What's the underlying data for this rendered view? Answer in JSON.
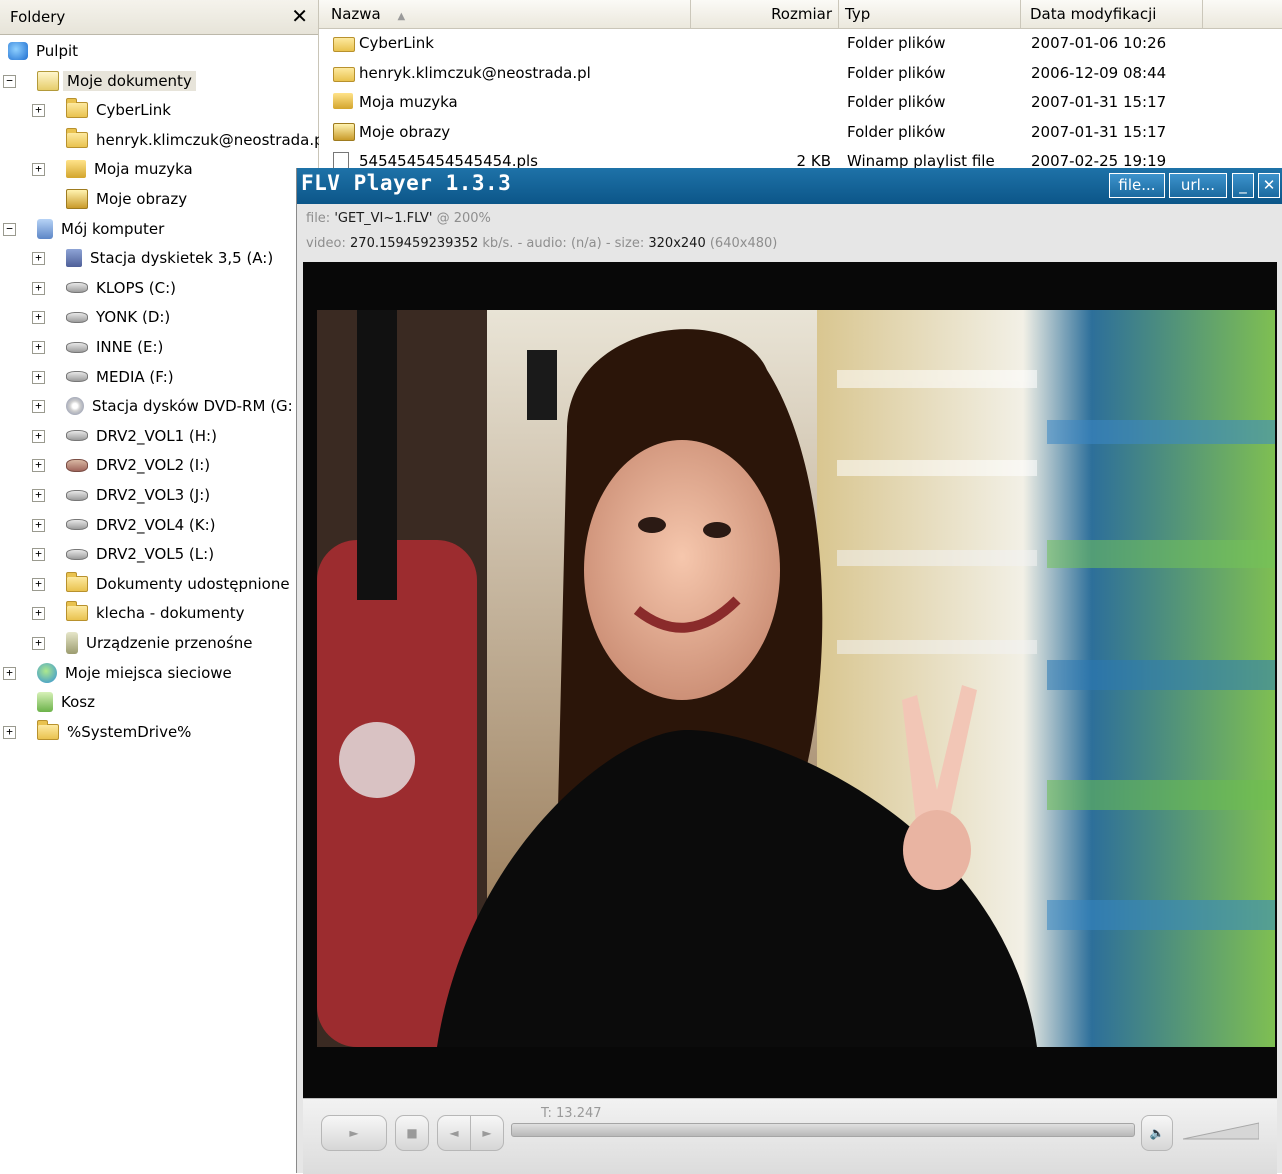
{
  "folders_pane": {
    "title": "Foldery",
    "close_label": "✕",
    "tree": [
      {
        "label": "Pulpit",
        "icon": "desktop-icon",
        "expander": ""
      },
      {
        "label": "Moje dokumenty",
        "icon": "mydocs-icon",
        "expander": "−",
        "selected": true
      },
      {
        "label": "CyberLink",
        "icon": "folder-icon",
        "expander": "+"
      },
      {
        "label": "henryk.klimczuk@neostrada.p",
        "icon": "folder-icon",
        "expander": ""
      },
      {
        "label": "Moja muzyka",
        "icon": "music-folder-icon",
        "expander": "+"
      },
      {
        "label": "Moje obrazy",
        "icon": "pictures-folder-icon",
        "expander": ""
      },
      {
        "label": "Mój komputer",
        "icon": "computer-icon",
        "expander": "−"
      },
      {
        "label": "Stacja dyskietek 3,5 (A:)",
        "icon": "floppy-icon",
        "expander": "+"
      },
      {
        "label": "KLOPS (C:)",
        "icon": "drive-icon",
        "expander": "+"
      },
      {
        "label": "YONK (D:)",
        "icon": "drive-icon",
        "expander": "+"
      },
      {
        "label": "INNE (E:)",
        "icon": "drive-icon",
        "expander": "+"
      },
      {
        "label": "MEDIA (F:)",
        "icon": "drive-icon",
        "expander": "+"
      },
      {
        "label": "Stacja dysków DVD-RM (G:",
        "icon": "dvd-drive-icon",
        "expander": "+"
      },
      {
        "label": "DRV2_VOL1 (H:)",
        "icon": "drive-icon",
        "expander": "+"
      },
      {
        "label": "DRV2_VOL2 (I:)",
        "icon": "shared-drive-icon",
        "expander": "+"
      },
      {
        "label": "DRV2_VOL3 (J:)",
        "icon": "drive-icon",
        "expander": "+"
      },
      {
        "label": "DRV2_VOL4 (K:)",
        "icon": "drive-icon",
        "expander": "+"
      },
      {
        "label": "DRV2_VOL5 (L:)",
        "icon": "drive-icon",
        "expander": "+"
      },
      {
        "label": "Dokumenty udostępnione",
        "icon": "shared-folder-icon",
        "expander": "+"
      },
      {
        "label": "klecha - dokumenty",
        "icon": "folder-icon",
        "expander": "+"
      },
      {
        "label": "Urządzenie przenośne",
        "icon": "usb-device-icon",
        "expander": "+"
      },
      {
        "label": "Moje miejsca sieciowe",
        "icon": "network-icon",
        "expander": "+"
      },
      {
        "label": "Kosz",
        "icon": "recycle-bin-icon",
        "expander": ""
      },
      {
        "label": "%SystemDrive%",
        "icon": "folder-icon",
        "expander": "+"
      }
    ]
  },
  "file_list": {
    "columns": [
      "Nazwa",
      "Rozmiar",
      "Typ",
      "Data modyfikacji"
    ],
    "sort_indicator": "▲",
    "rows": [
      {
        "name": "CyberLink",
        "size": "",
        "type": "Folder plików",
        "date": "2007-01-06 10:26",
        "icon": "folder-icon"
      },
      {
        "name": "henryk.klimczuk@neostrada.pl",
        "size": "",
        "type": "Folder plików",
        "date": "2006-12-09 08:44",
        "icon": "folder-icon"
      },
      {
        "name": "Moja muzyka",
        "size": "",
        "type": "Folder plików",
        "date": "2007-01-31 15:17",
        "icon": "music-folder-icon"
      },
      {
        "name": "Moje obrazy",
        "size": "",
        "type": "Folder plików",
        "date": "2007-01-31 15:17",
        "icon": "pictures-folder-icon"
      },
      {
        "name": "5454545454545454.pls",
        "size": "2 KB",
        "type": "Winamp playlist file",
        "date": "2007-02-25 19:19",
        "icon": "playlist-file-icon"
      }
    ]
  },
  "player": {
    "title": "FLV Player 1.3.3",
    "buttons": {
      "file": "file...",
      "url": "url...",
      "minimize": "_",
      "close": "✕"
    },
    "info": {
      "file_prefix": "file:",
      "file_name": "'GET_VI~1.FLV'",
      "zoom": "@ 200%",
      "video_prefix": "video:",
      "video_rate": "270.159459239352",
      "video_unit": "kb/s. - audio:",
      "audio": "(n/a)",
      "size_prefix": "- size:",
      "size": "320x240",
      "size_scaled": "(640x480)"
    },
    "controls": {
      "play_label": "►",
      "stop_label": "■",
      "prev_label": "◄",
      "next_label": "►",
      "time": "T: 13.247",
      "volume_icon": "speaker-icon"
    },
    "accent_color": "#0c5689"
  }
}
